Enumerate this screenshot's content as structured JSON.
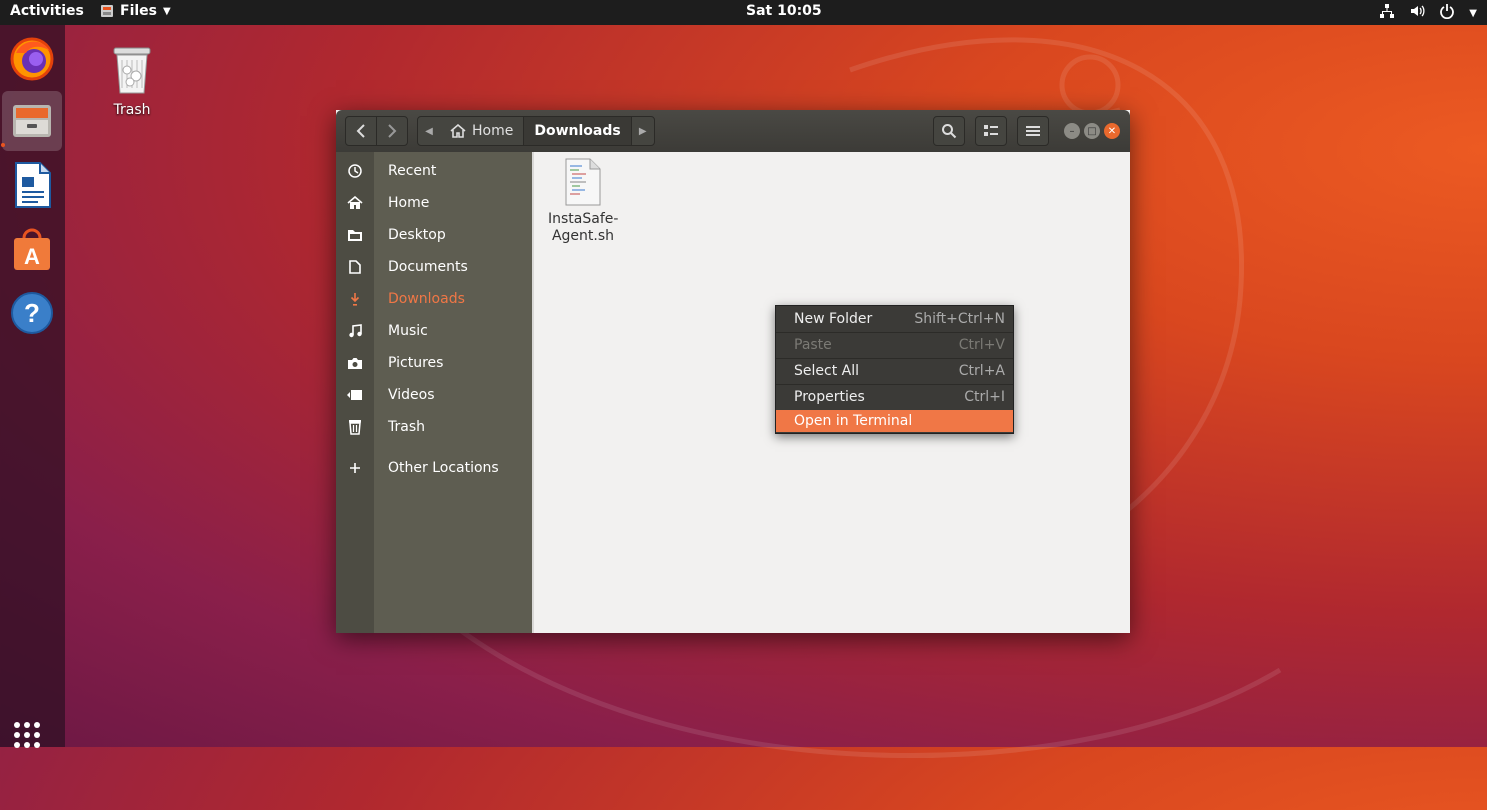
{
  "topbar": {
    "activities": "Activities",
    "app_menu": "Files",
    "clock": "Sat 10:05",
    "tray_icons": [
      "network-icon",
      "volume-icon",
      "power-icon",
      "chevron-down-icon"
    ]
  },
  "dock": {
    "items": [
      {
        "name": "firefox-icon"
      },
      {
        "name": "files-icon",
        "running": true
      },
      {
        "name": "libreoffice-writer-icon"
      },
      {
        "name": "software-center-icon"
      },
      {
        "name": "help-icon"
      }
    ],
    "show_apps": "show-applications-icon"
  },
  "desktop": {
    "trash_label": "Trash"
  },
  "window": {
    "path": {
      "home": "Home",
      "current": "Downloads"
    },
    "sidebar": [
      {
        "label": "Recent",
        "icon": "clock-icon"
      },
      {
        "label": "Home",
        "icon": "home-icon"
      },
      {
        "label": "Desktop",
        "icon": "folder-icon"
      },
      {
        "label": "Documents",
        "icon": "document-icon"
      },
      {
        "label": "Downloads",
        "icon": "download-icon",
        "active": true
      },
      {
        "label": "Music",
        "icon": "music-icon"
      },
      {
        "label": "Pictures",
        "icon": "camera-icon"
      },
      {
        "label": "Videos",
        "icon": "video-icon"
      },
      {
        "label": "Trash",
        "icon": "trash-icon"
      },
      {
        "label": "Other Locations",
        "icon": "plus-icon"
      }
    ],
    "files": [
      {
        "name_line1": "InstaSafe-",
        "name_line2": "Agent.sh"
      }
    ]
  },
  "context_menu": {
    "items": [
      {
        "label": "New Folder",
        "accel": "Shift+Ctrl+N"
      },
      {
        "label": "Paste",
        "accel": "Ctrl+V",
        "disabled": true
      },
      {
        "label": "Select All",
        "accel": "Ctrl+A"
      },
      {
        "label": "Properties",
        "accel": "Ctrl+I"
      },
      {
        "label": "Open in Terminal",
        "accel": "",
        "highlighted": true
      }
    ]
  },
  "colors": {
    "accent": "#f07746",
    "sidebar": "#5e5d51",
    "headerbar": "#3c3b37"
  }
}
